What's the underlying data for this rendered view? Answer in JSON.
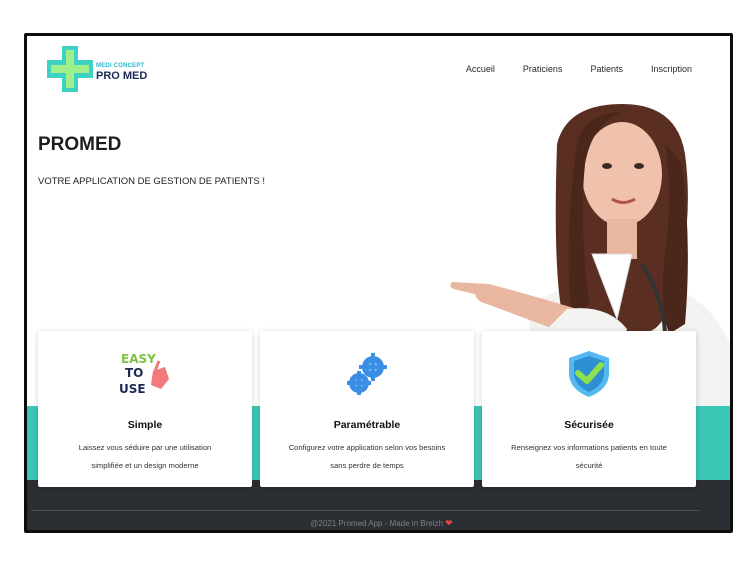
{
  "logo": {
    "small": "MEDI CONCEPT",
    "big": "PRO MED"
  },
  "nav": [
    "Accueil",
    "Praticiens",
    "Patients",
    "Inscription"
  ],
  "hero": {
    "title": "PROMED",
    "subtitle": "VOTRE APPLICATION DE GESTION DE PATIENTS !"
  },
  "cards": [
    {
      "icon": "easy-to-use-icon",
      "icon_text": [
        "EASY",
        "TO",
        "USE"
      ],
      "title": "Simple",
      "text_line1": "Laissez vous séduire par une utilisation",
      "text_line2": "simplifiée et un design moderne"
    },
    {
      "icon": "gears-icon",
      "title": "Paramétrable",
      "text_line1": "Configurez votre application selon vos besoins",
      "text_line2": "sans perdre de temps"
    },
    {
      "icon": "shield-check-icon",
      "title": "Sécurisée",
      "text_line1": "Renseignez vos informations patients en toute",
      "text_line2": "sécurité"
    }
  ],
  "footer": {
    "text": "@2021 Promed App - Made in Breizh"
  },
  "colors": {
    "teal": "#3ac7b6",
    "footer": "#2b2e33",
    "navy": "#1e2a55",
    "heart": "#e64545"
  }
}
